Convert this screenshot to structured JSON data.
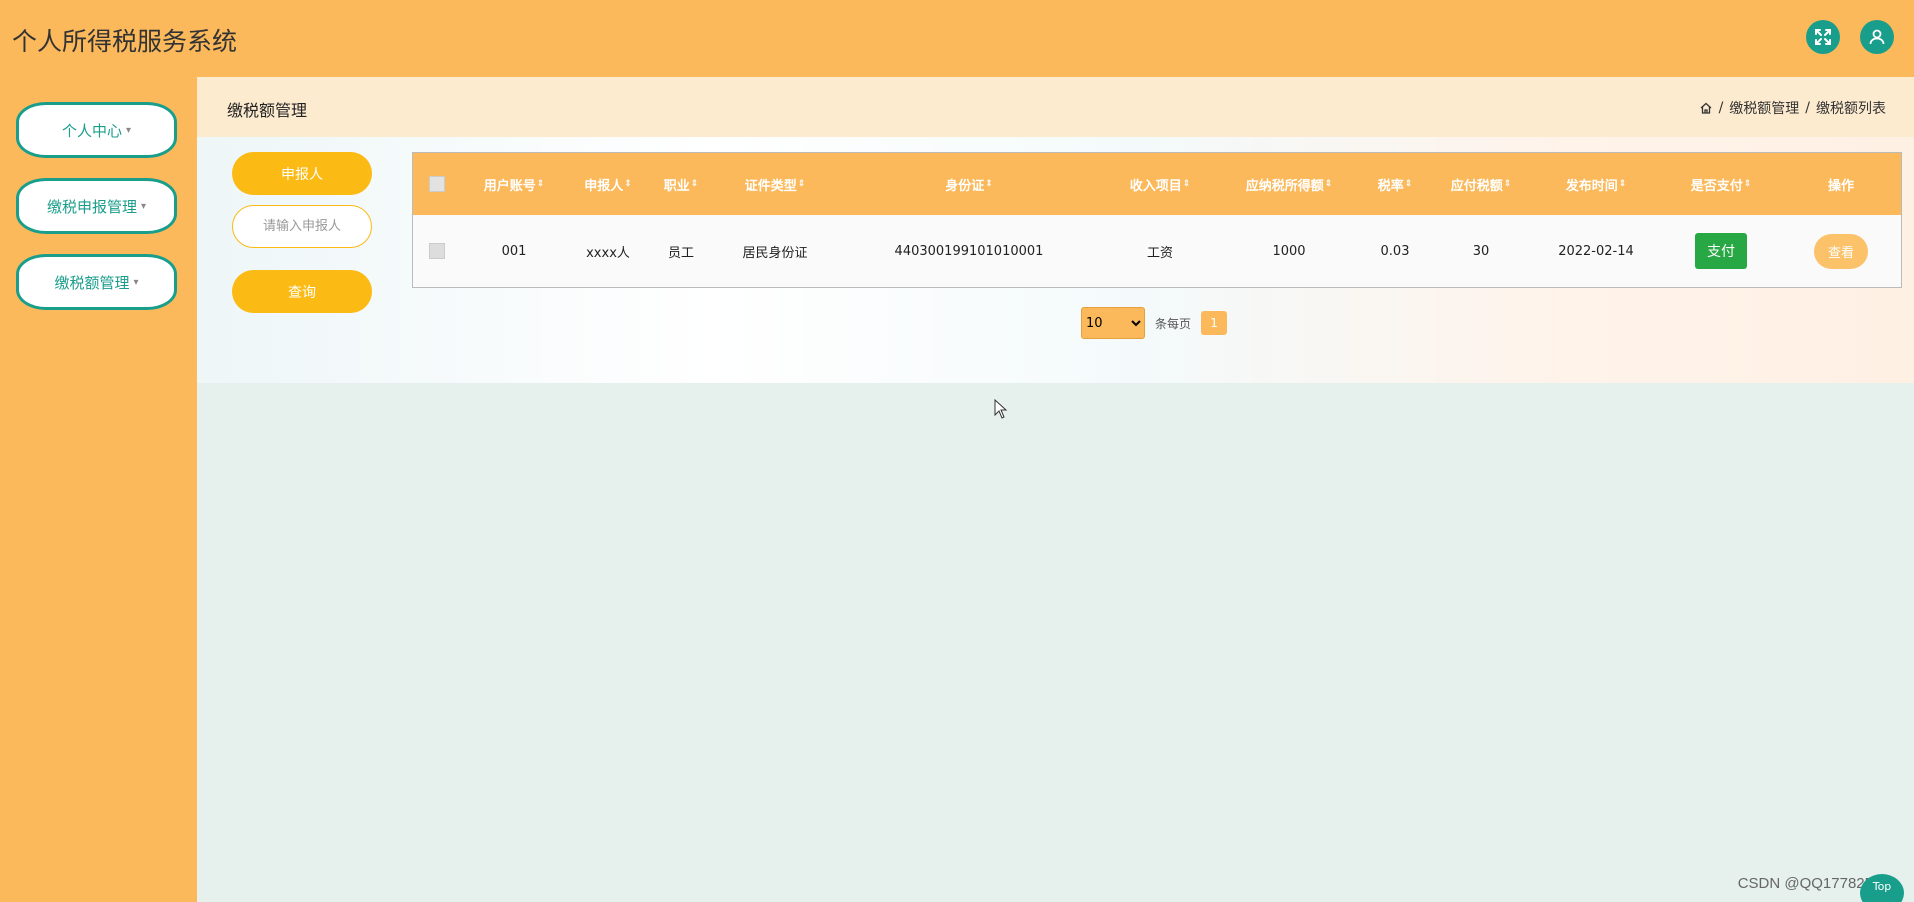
{
  "app": {
    "title": "个人所得税服务系统"
  },
  "header_icons": [
    {
      "name": "fullscreen-icon",
      "color": "#1a9e8c"
    },
    {
      "name": "user-icon",
      "color": "#1a9e8c"
    }
  ],
  "sidebar": {
    "items": [
      {
        "label": "个人中心"
      },
      {
        "label": "缴税申报管理"
      },
      {
        "label": "缴税额管理"
      }
    ]
  },
  "page": {
    "title": "缴税额管理",
    "breadcrumb": [
      "缴税额管理",
      "缴税额列表"
    ],
    "breadcrumb_sep": "/"
  },
  "search": {
    "field_label": "申报人",
    "placeholder": "请输入申报人",
    "button_label": "查询"
  },
  "table": {
    "columns": [
      "用户账号",
      "申报人",
      "职业",
      "证件类型",
      "身份证",
      "收入项目",
      "应纳税所得额",
      "税率",
      "应付税额",
      "发布时间",
      "是否支付",
      "操作"
    ],
    "rows": [
      {
        "account": "001",
        "declarer": "xxxx人",
        "occupation": "员工",
        "id_type": "居民身份证",
        "id_number": "440300199101010001",
        "income_item": "工资",
        "taxable_income": "1000",
        "tax_rate": "0.03",
        "tax_payable": "30",
        "publish_time": "2022-02-14",
        "pay_label": "支付",
        "view_label": "查看"
      }
    ]
  },
  "pagination": {
    "page_size": "10",
    "page_size_options": [
      "10"
    ],
    "per_page_label": "条每页",
    "current_page": "1"
  },
  "colors": {
    "primary": "#fbb95b",
    "accent": "#1a9e8c",
    "button_yellow": "#fbba14",
    "pay_green": "#28a745"
  },
  "watermark": "CSDN @QQ177825331",
  "top_button": "Top"
}
